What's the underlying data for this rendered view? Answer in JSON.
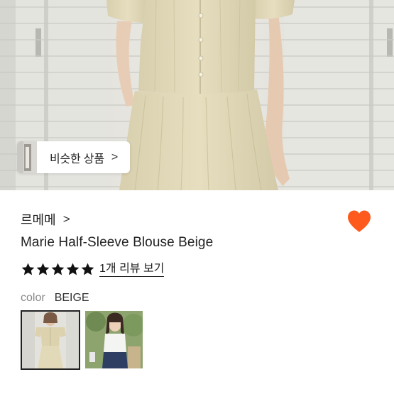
{
  "hero": {
    "image": "product-photo-beige-blouse-and-skirt",
    "similar_button": {
      "label": "비슷한 상품",
      "chevron": ">"
    }
  },
  "product": {
    "brand": "르메메",
    "brand_chevron": ">",
    "title": "Marie Half-Sleeve Blouse Beige",
    "wishlist_icon": "heart-icon",
    "wishlist_color": "#fe5a1d",
    "rating": {
      "stars": 5,
      "review_link": "1개 리뷰 보기"
    },
    "option": {
      "label": "color",
      "value": "BEIGE"
    },
    "swatches": [
      {
        "name": "beige-outfit",
        "selected": true
      },
      {
        "name": "white-top-outfit",
        "selected": false
      }
    ]
  }
}
